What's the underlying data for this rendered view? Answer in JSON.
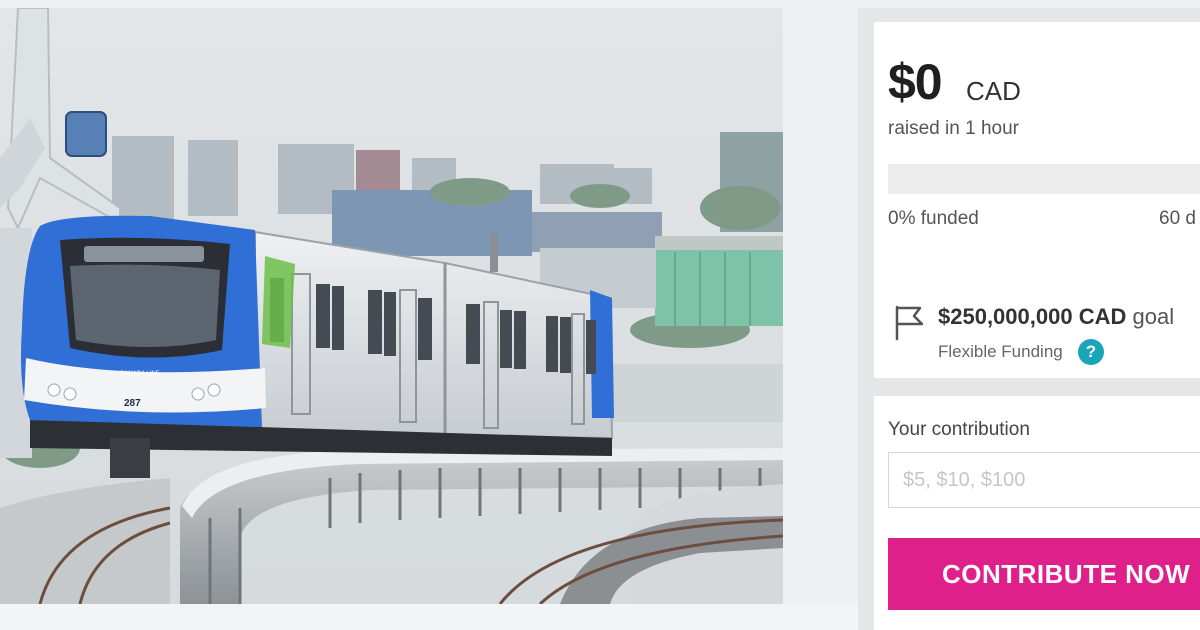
{
  "campaign": {
    "raised_amount": "$0",
    "raised_currency": "CAD",
    "raised_time": "raised in 1 hour",
    "progress_fraction": 0,
    "funded_label": "0% funded",
    "days_left_label": "60 d",
    "goal_amount": "$250,000,000 CAD",
    "goal_word": "goal",
    "funding_type": "Flexible Funding",
    "help_symbol": "?"
  },
  "contribution": {
    "label": "Your contribution",
    "placeholder": "$5, $10, $100",
    "button_label": "CONTRIBUTE NOW"
  },
  "train": {
    "car_number": "287",
    "brand_text": "CANADA LINE"
  },
  "colors": {
    "accent_teal": "#1aa4b8",
    "button_pink": "#e0208a",
    "train_blue": "#2f6fd6",
    "train_green": "#6cc04a"
  }
}
